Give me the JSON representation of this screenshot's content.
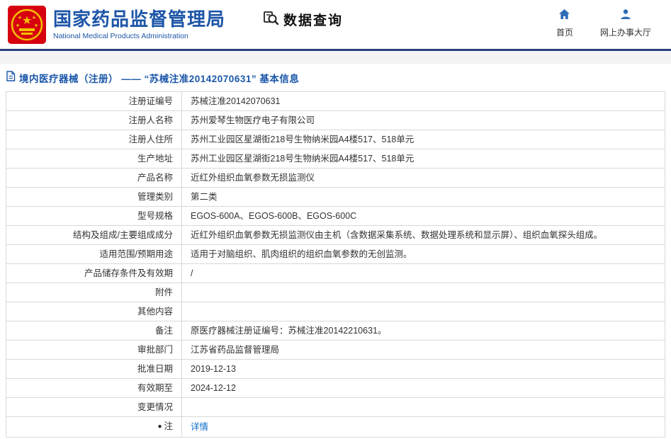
{
  "header": {
    "agency_name_cn": "国家药品监督管理局",
    "agency_name_en": "National Medical Products Administration",
    "query_title": "数据查询",
    "nav_home": "首页",
    "nav_hall": "网上办事大厅"
  },
  "breadcrumb": {
    "title": "境内医疗器械（注册） —— “苏械注准20142070631” 基本信息"
  },
  "colors": {
    "brand_blue": "#1d55a7",
    "divider_blue": "#28417f",
    "link_blue": "#0a6cc8",
    "nav_icon_blue": "#2e6cb5",
    "emblem_red": "#d7000f",
    "emblem_gold": "#f3c200",
    "table_border": "#d8d8d8"
  },
  "table": {
    "rows": [
      {
        "label": "注册证编号",
        "value": "苏械注准20142070631"
      },
      {
        "label": "注册人名称",
        "value": "苏州爱琴生物医疗电子有限公司"
      },
      {
        "label": "注册人住所",
        "value": "苏州工业园区星湖街218号生物纳米园A4楼517、518单元"
      },
      {
        "label": "生产地址",
        "value": "苏州工业园区星湖街218号生物纳米园A4楼517、518单元"
      },
      {
        "label": "产品名称",
        "value": "近红外组织血氧参数无损监测仪"
      },
      {
        "label": "管理类别",
        "value": "第二类"
      },
      {
        "label": "型号规格",
        "value": "EGOS-600A、EGOS-600B、EGOS-600C"
      },
      {
        "label": "结构及组成/主要组成成分",
        "value": "近红外组织血氧参数无损监测仪由主机（含数据采集系统、数据处理系统和显示屏）、组织血氧探头组成。"
      },
      {
        "label": "适用范围/预期用途",
        "value": "适用于对脑组织、肌肉组织的组织血氧参数的无创监测。"
      },
      {
        "label": "产品储存条件及有效期",
        "value": "/"
      },
      {
        "label": "附件",
        "value": ""
      },
      {
        "label": "其他内容",
        "value": ""
      },
      {
        "label": "备注",
        "value": "原医疗器械注册证编号：苏械注准20142210631。"
      },
      {
        "label": "审批部门",
        "value": "江苏省药品监督管理局"
      },
      {
        "label": "批准日期",
        "value": "2019-12-13"
      },
      {
        "label": "有效期至",
        "value": "2024-12-12"
      },
      {
        "label": "变更情况",
        "value": ""
      },
      {
        "label": "注",
        "value": "",
        "bullet": true,
        "link": "详情"
      }
    ]
  }
}
